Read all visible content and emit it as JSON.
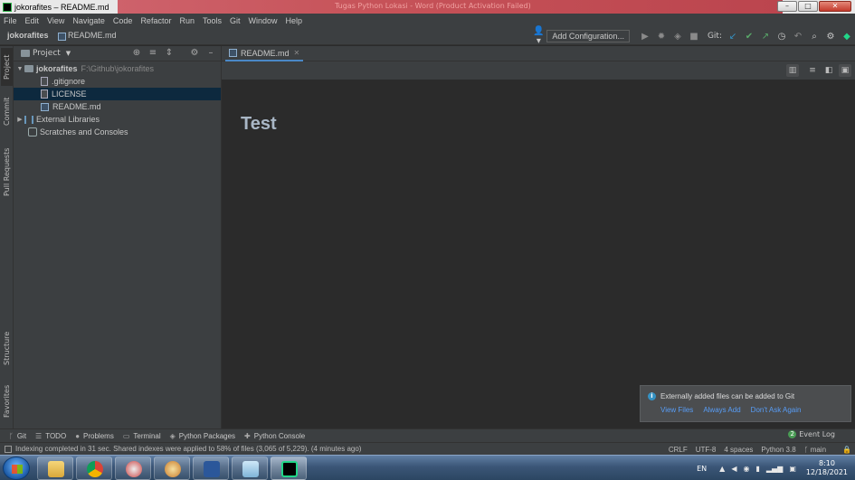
{
  "window": {
    "title": "jokorafites – README.md",
    "background_title": "Tugas Python Lokasi - Word (Product Activation Failed)"
  },
  "menu": [
    "File",
    "Edit",
    "View",
    "Navigate",
    "Code",
    "Refactor",
    "Run",
    "Tools",
    "Git",
    "Window",
    "Help"
  ],
  "breadcrumb": {
    "project": "jokorafites",
    "file": "README.md"
  },
  "toolbar": {
    "add_configuration": "Add Configuration...",
    "git_label": "Git:"
  },
  "project_panel": {
    "title": "Project",
    "root": {
      "name": "jokorafites",
      "path": "F:\\Github\\jokorafites"
    },
    "items": [
      ".gitignore",
      "LICENSE",
      "README.md"
    ],
    "external_libraries": "External Libraries",
    "scratches": "Scratches and Consoles"
  },
  "left_tabs": [
    "Project",
    "Commit",
    "Pull Requests",
    "Structure",
    "Favorites"
  ],
  "editor": {
    "tab_label": "README.md",
    "heading": "Test"
  },
  "notification": {
    "message": "Externally added files can be added to Git",
    "actions": [
      "View Files",
      "Always Add",
      "Don't Ask Again"
    ]
  },
  "bottom_tools": [
    "Git",
    "TODO",
    "Problems",
    "Terminal",
    "Python Packages",
    "Python Console"
  ],
  "event_log": {
    "label": "Event Log",
    "count": "2"
  },
  "status": {
    "message": "Indexing completed in 31 sec. Shared indexes were applied to 58% of files (3,065 of 5,229). (4 minutes ago)",
    "line_sep": "CRLF",
    "encoding": "UTF-8",
    "indent": "4 spaces",
    "interpreter": "Python 3.8",
    "branch": "main"
  },
  "taskbar": {
    "lang": "EN",
    "time": "8:10",
    "date": "12/18/2021"
  },
  "colors": {
    "accent": "#4a88c7",
    "editor_bg": "#2b2b2b",
    "panel_bg": "#3c3f41",
    "selection": "#0d293e",
    "link": "#589df6",
    "heading": "#a9b7c6"
  }
}
